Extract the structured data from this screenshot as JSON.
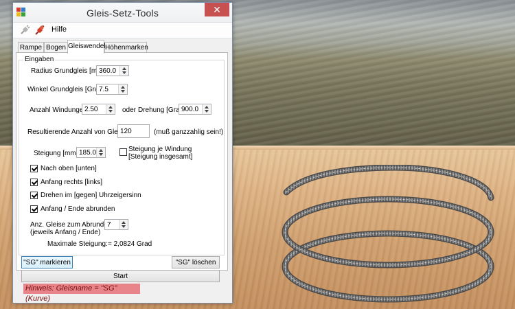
{
  "window": {
    "title": "Gleis-Setz-Tools",
    "close_symbol": "✕"
  },
  "menu": {
    "help_label": "Hilfe"
  },
  "tabs": [
    {
      "label": "Rampe",
      "active": false
    },
    {
      "label": "Bogen",
      "active": false
    },
    {
      "label": "Gleiswendel",
      "active": true
    },
    {
      "label": "Höhenmarken",
      "active": false
    }
  ],
  "group": {
    "label": "Eingaben"
  },
  "fields": {
    "radius": {
      "label": "Radius Grundgleis [mm]:",
      "value": "360.0"
    },
    "angle": {
      "label": "Winkel Grundgleis [Grad]:",
      "value": "7.5"
    },
    "windings": {
      "label": "Anzahl Windungen:",
      "value": "2.50"
    },
    "or_label": "oder",
    "rotation": {
      "label": "Drehung [Grad]:",
      "value": "900.0"
    },
    "result": {
      "label": "Resultierende Anzahl von Gleisen:",
      "value": "120",
      "note": "(muß ganzzahlig sein!)"
    },
    "slope": {
      "label": "Steigung [mm]:",
      "value": "185.0"
    },
    "slope_per_winding": {
      "label_line1": "Steigung je Windung",
      "label_line2": "[Steigung insgesamt]",
      "checked": false
    },
    "up": {
      "label": "Nach oben [unten]",
      "checked": true
    },
    "start_right": {
      "label": "Anfang rechts [links]",
      "checked": true
    },
    "clockwise": {
      "label": "Drehen im [gegen] Uhrzeigersinn",
      "checked": true
    },
    "round_ends": {
      "label": "Anfang / Ende abrunden",
      "checked": true
    },
    "round_count": {
      "label_line1": "Anz. Gleise zum Abrunden",
      "label_line2": "(jeweils Anfang / Ende)",
      "value": "7"
    },
    "max_slope": {
      "label": "Maximale Steigung:",
      "value": "= 2,0824 Grad"
    }
  },
  "buttons": {
    "mark": "\"SG\" markieren",
    "delete": "\"SG\" löschen",
    "start": "Start"
  },
  "hint": "Hinweis: Gleisname = \"SG\" (Kurve)"
}
